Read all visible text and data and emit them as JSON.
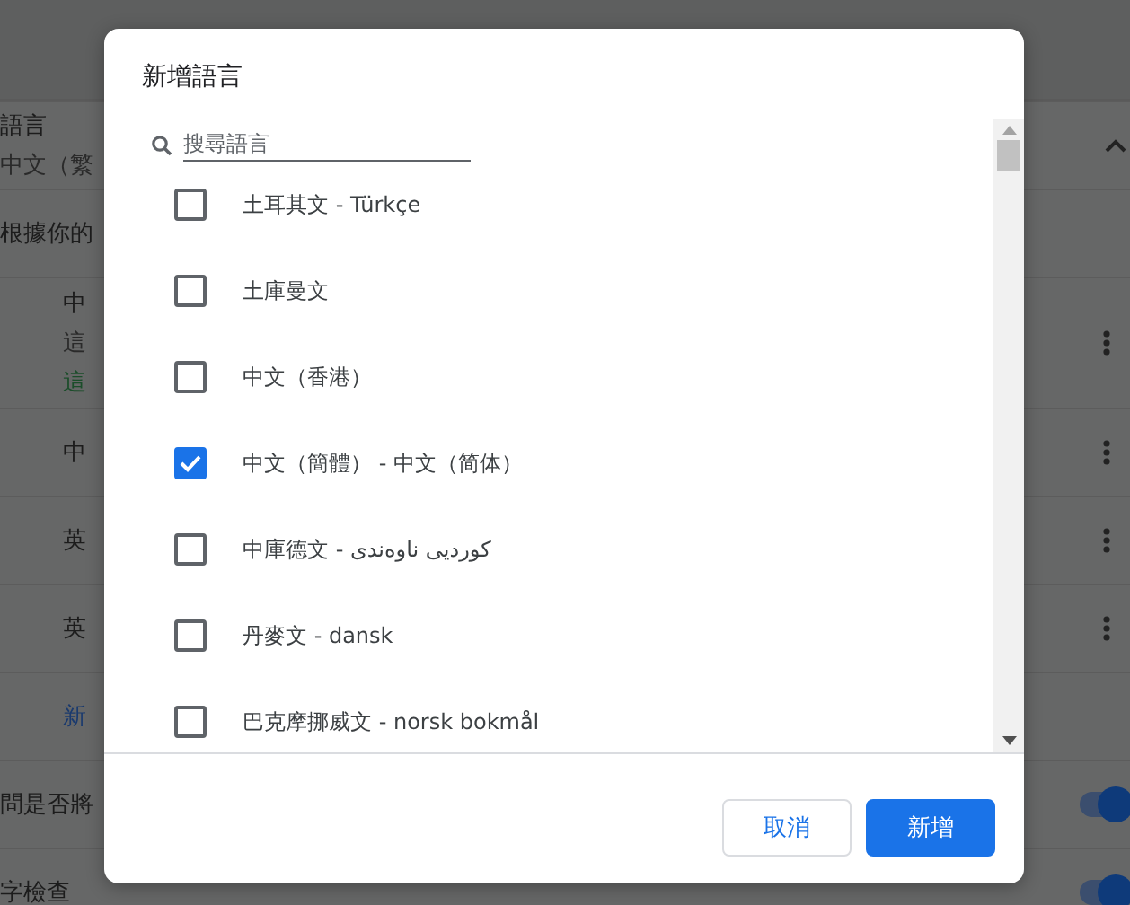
{
  "background": {
    "rows": [
      {
        "lines": [
          {
            "text": "語言",
            "kind": "normal"
          },
          {
            "text": "中文（繁",
            "kind": "muted"
          }
        ],
        "indent": false,
        "kind": "expandable"
      },
      {
        "lines": [
          {
            "text": "根據你的",
            "kind": "normal"
          }
        ],
        "indent": false,
        "kind": "plain"
      },
      {
        "lines": [
          {
            "text": "中",
            "kind": "normal"
          },
          {
            "text": "這",
            "kind": "muted"
          },
          {
            "text": "這",
            "kind": "green"
          }
        ],
        "indent": true,
        "kind": "menu"
      },
      {
        "lines": [
          {
            "text": "中",
            "kind": "normal"
          }
        ],
        "indent": true,
        "kind": "menu"
      },
      {
        "lines": [
          {
            "text": "英",
            "kind": "normal"
          }
        ],
        "indent": true,
        "kind": "menu"
      },
      {
        "lines": [
          {
            "text": "英",
            "kind": "normal"
          }
        ],
        "indent": true,
        "kind": "menu"
      },
      {
        "lines": [
          {
            "text": "新",
            "kind": "link"
          }
        ],
        "indent": true,
        "kind": "plain"
      },
      {
        "lines": [
          {
            "text": "問是否將",
            "kind": "normal"
          }
        ],
        "indent": false,
        "kind": "toggle",
        "on": true
      },
      {
        "lines": [
          {
            "text": "字檢查",
            "kind": "normal"
          }
        ],
        "indent": false,
        "kind": "toggle",
        "on": true
      }
    ]
  },
  "dialog": {
    "title": "新增語言",
    "search": {
      "placeholder": "搜尋語言"
    },
    "languages": [
      {
        "label": "土耳其文 - Türkçe",
        "checked": false
      },
      {
        "label": "土庫曼文",
        "checked": false
      },
      {
        "label": "中文（香港）",
        "checked": false
      },
      {
        "label": "中文（簡體） - 中文（简体）",
        "checked": true
      },
      {
        "label": "中庫德文 - کوردیی ناوەندی",
        "checked": false
      },
      {
        "label": "丹麥文 - dansk",
        "checked": false
      },
      {
        "label": "巴克摩挪威文 - norsk bokmål",
        "checked": false
      }
    ],
    "buttons": [
      {
        "label": "取消",
        "kind": "secondary"
      },
      {
        "label": "新增",
        "kind": "primary"
      }
    ]
  }
}
